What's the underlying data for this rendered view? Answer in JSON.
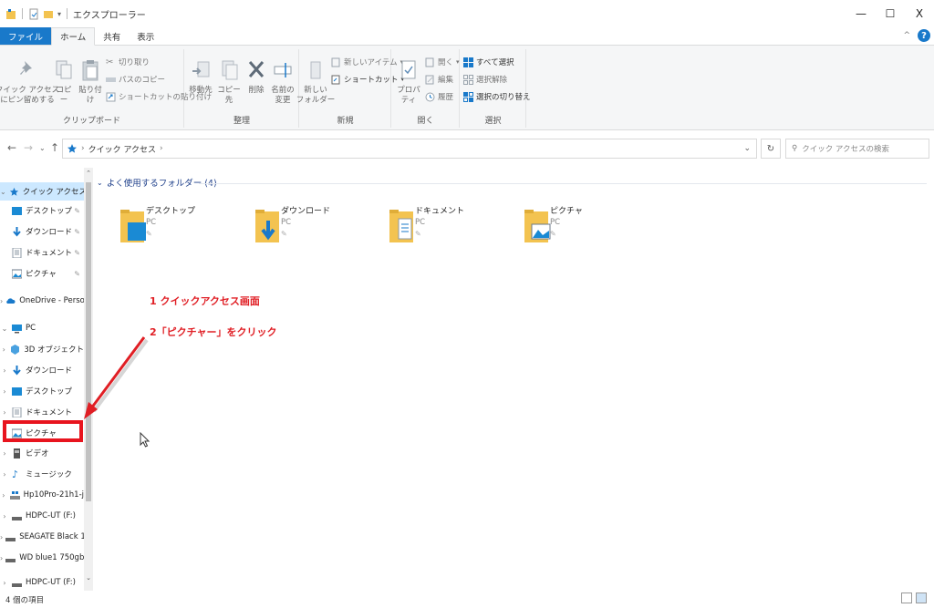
{
  "window": {
    "title": "エクスプローラー",
    "controls": {
      "minimize": "—",
      "maximize": "☐",
      "close": "X"
    }
  },
  "ribbon": {
    "tabs": [
      {
        "label": "ファイル"
      },
      {
        "label": "ホーム"
      },
      {
        "label": "共有"
      },
      {
        "label": "表示"
      }
    ],
    "help": "?",
    "collapse": "^",
    "clipboard": {
      "label": "クリップボード",
      "pin_quick_access": "クイック アクセス\nにピン留めする",
      "copy": "コピー",
      "paste": "貼り付け",
      "cut": "切り取り",
      "copy_path": "パスのコピー",
      "paste_shortcut": "ショートカットの貼り付け"
    },
    "organize": {
      "label": "整理",
      "move_to": "移動先",
      "copy_to": "コピー先",
      "delete": "削除",
      "rename": "名前の\n変更"
    },
    "new": {
      "label": "新規",
      "new_folder": "新しい\nフォルダー",
      "new_item": "新しいアイテム",
      "shortcut": "ショートカット"
    },
    "open": {
      "label": "開く",
      "properties": "プロパティ",
      "open": "開く",
      "edit": "編集",
      "history": "履歴"
    },
    "select": {
      "label": "選択",
      "select_all": "すべて選択",
      "select_none": "選択解除",
      "invert": "選択の切り替え"
    }
  },
  "address": {
    "path": "クイック アクセス",
    "search_placeholder": "クイック アクセスの検索"
  },
  "nav": {
    "items": [
      {
        "label": "クイック アクセス",
        "chev": "⌄",
        "pin": ""
      },
      {
        "label": "デスクトップ",
        "chev": "",
        "pin": "✎"
      },
      {
        "label": "ダウンロード",
        "chev": "",
        "pin": "✎"
      },
      {
        "label": "ドキュメント",
        "chev": "",
        "pin": "✎"
      },
      {
        "label": "ピクチャ",
        "chev": "",
        "pin": "✎"
      },
      {
        "label": "OneDrive - Person",
        "chev": "›",
        "pin": ""
      },
      {
        "label": "PC",
        "chev": "⌄",
        "pin": ""
      },
      {
        "label": "3D オブジェクト",
        "chev": "›",
        "pin": ""
      },
      {
        "label": "ダウンロード",
        "chev": "›",
        "pin": ""
      },
      {
        "label": "デスクトップ",
        "chev": "›",
        "pin": ""
      },
      {
        "label": "ドキュメント",
        "chev": "›",
        "pin": ""
      },
      {
        "label": "ピクチャ",
        "chev": "›",
        "pin": ""
      },
      {
        "label": "ビデオ",
        "chev": "›",
        "pin": ""
      },
      {
        "label": "ミュージック",
        "chev": "›",
        "pin": ""
      },
      {
        "label": "Hp10Pro-21h1-j",
        "chev": "›",
        "pin": ""
      },
      {
        "label": "HDPC-UT (F:)",
        "chev": "›",
        "pin": ""
      },
      {
        "label": "SEAGATE Black 1",
        "chev": "›",
        "pin": ""
      },
      {
        "label": "WD blue1 750gb",
        "chev": "›",
        "pin": ""
      },
      {
        "label": "HDPC-UT (F:)",
        "chev": "›",
        "pin": ""
      }
    ]
  },
  "content": {
    "section_title": "よく使用するフォルダー (4)",
    "folders": [
      {
        "name": "デスクトップ",
        "location": "PC",
        "pin": "✎"
      },
      {
        "name": "ダウンロード",
        "location": "PC",
        "pin": "✎"
      },
      {
        "name": "ドキュメント",
        "location": "PC",
        "pin": "✎"
      },
      {
        "name": "ピクチャ",
        "location": "PC",
        "pin": "✎"
      }
    ]
  },
  "annotations": {
    "step1": "1 クイックアクセス画面",
    "step2": "2「ピクチャー」をクリック"
  },
  "status": {
    "item_count": "4 個の項目"
  },
  "colors": {
    "accent": "#1979ca",
    "annotation": "#e01e24",
    "folder": "#f3c350"
  }
}
